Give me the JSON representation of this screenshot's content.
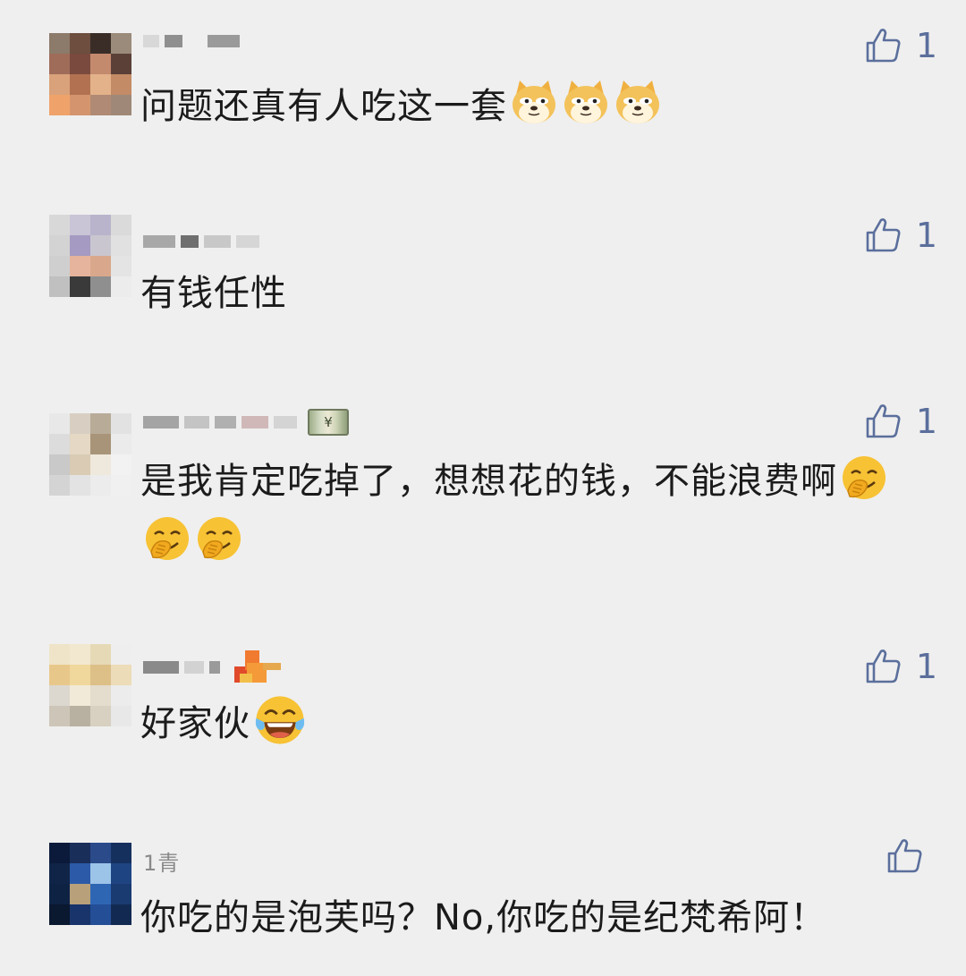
{
  "comments": [
    {
      "nickname": "",
      "text": "问题还真有人吃这一套",
      "emoji": [
        "doge-icon",
        "doge-icon",
        "doge-icon"
      ],
      "likes": "1"
    },
    {
      "nickname": "",
      "text": "有钱任性",
      "emoji": [],
      "likes": "1"
    },
    {
      "nickname": "",
      "badge": "money-icon",
      "badge_symbol": "¥",
      "text": "是我肯定吃掉了，想想花的钱，不能浪费啊",
      "emoji": [
        "facepalm-laugh-icon",
        "facepalm-laugh-icon",
        "facepalm-laugh-icon"
      ],
      "likes": "1"
    },
    {
      "nickname": "",
      "badge": "fire-icon",
      "text": "好家伙",
      "emoji": [
        "tears-of-joy-icon"
      ],
      "likes": "1"
    },
    {
      "nickname": "1青",
      "text": "你吃的是泡芙吗？No,你吃的是纪梵希阿！",
      "emoji": [],
      "likes": ""
    }
  ],
  "colors": {
    "background": "#efefef",
    "text": "#1b1b1b",
    "like": "#5b6f9c"
  }
}
